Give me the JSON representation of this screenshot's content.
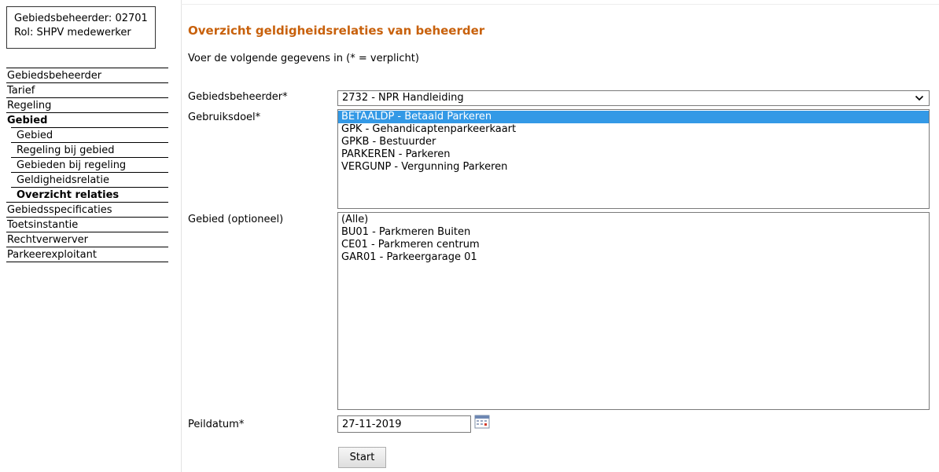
{
  "user": {
    "line1": "Gebiedsbeheerder: 02701",
    "line2": "Rol: SHPV medewerker"
  },
  "nav": [
    {
      "label": "Gebiedsbeheerder",
      "level": 0,
      "bold": false
    },
    {
      "label": "Tarief",
      "level": 0,
      "bold": false
    },
    {
      "label": "Regeling",
      "level": 0,
      "bold": false
    },
    {
      "label": "Gebied",
      "level": 0,
      "bold": true
    },
    {
      "label": "Gebied",
      "level": 1,
      "bold": false
    },
    {
      "label": "Regeling bij gebied",
      "level": 1,
      "bold": false
    },
    {
      "label": "Gebieden bij regeling",
      "level": 1,
      "bold": false
    },
    {
      "label": "Geldigheidsrelatie",
      "level": 1,
      "bold": false
    },
    {
      "label": "Overzicht relaties",
      "level": 1,
      "bold": true
    },
    {
      "label": "Gebiedsspecificaties",
      "level": 0,
      "bold": false
    },
    {
      "label": "Toetsinstantie",
      "level": 0,
      "bold": false
    },
    {
      "label": "Rechtverwerver",
      "level": 0,
      "bold": false
    },
    {
      "label": "Parkeerexploitant",
      "level": 0,
      "bold": false
    }
  ],
  "page": {
    "title": "Overzicht geldigheidsrelaties van beheerder",
    "intro": "Voer de volgende gegevens in (* = verplicht)"
  },
  "form": {
    "beheerder": {
      "label": "Gebiedsbeheerder*",
      "value": "2732 - NPR Handleiding"
    },
    "gebruiksdoel": {
      "label": "Gebruiksdoel*",
      "options": [
        "BETAALDP - Betaald Parkeren",
        "GPK - Gehandicaptenparkeerkaart",
        "GPKB - Bestuurder",
        "PARKEREN - Parkeren",
        "VERGUNP - Vergunning Parkeren"
      ],
      "selected": 0
    },
    "gebied": {
      "label": "Gebied (optioneel)",
      "options": [
        "(Alle)",
        "BU01 - Parkmeren Buiten",
        "CE01 - Parkmeren centrum",
        "GAR01 - Parkeergarage 01"
      ]
    },
    "peildatum": {
      "label": "Peildatum*",
      "value": "27-11-2019"
    },
    "start_label": "Start"
  },
  "colors": {
    "title": "#c8610c",
    "selection": "#3399e6"
  }
}
